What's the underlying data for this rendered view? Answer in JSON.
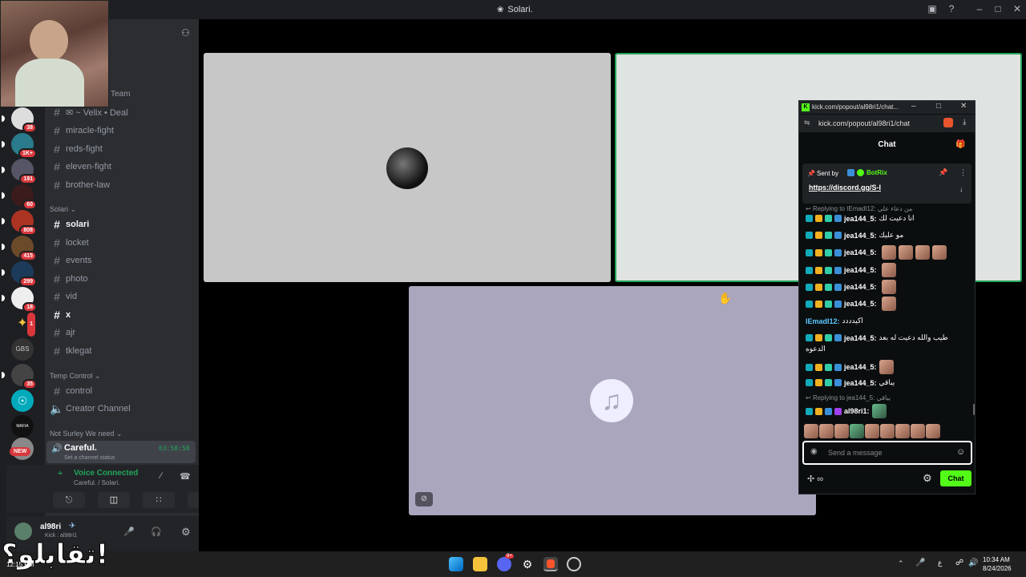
{
  "window": {
    "title": "Solari."
  },
  "sidebar": {
    "server_badges": [
      "38",
      "1K+",
      "191",
      "60",
      "808",
      "415",
      "299",
      "18",
      "1",
      "35"
    ],
    "new_badge": "NEW",
    "team_label": "Team",
    "channels_top": [
      "✉ ~ Velix • Deal",
      "miracle-fight",
      "reds-fight",
      "eleven-fight",
      "brother-law"
    ],
    "category_solari": "Solari",
    "channels_solari": [
      "solari",
      "locket",
      "events",
      "photo",
      "vid",
      "x",
      "ajr",
      "tklegat"
    ],
    "category_temp": "Temp Control",
    "channels_temp": [
      "control",
      "Creator Channel"
    ],
    "category_voice": "Not Surley We need",
    "voice_channel": "Careful.",
    "voice_timer": "63:58:58",
    "voice_status": "Set a channel status",
    "voice_connected": "Voice Connected",
    "voice_location": "Careful. / Solari.",
    "username": "al98ri",
    "user_status": "Kick : al98ri1"
  },
  "popout": {
    "window_title": "kick.com/popout/al98ri1/chat...",
    "url": "kick.com/popout/al98ri1/chat",
    "chat_title": "Chat",
    "pinned_sent_by": "Sent by",
    "pinned_user": "BotRix",
    "pinned_link": "https://discord.gg/S-I",
    "replying1": "Replying to IEmadI12: من دعاء علي",
    "messages": [
      {
        "user": "jea144_5:",
        "text": "انا دعيت لك"
      },
      {
        "user": "jea144_5:",
        "text": "مو عليك"
      },
      {
        "user": "jea144_5:",
        "text": ""
      },
      {
        "user": "jea144_5:",
        "text": ""
      },
      {
        "user": "jea144_5:",
        "text": ""
      },
      {
        "user": "jea144_5:",
        "text": ""
      }
    ],
    "emad_msg_user": "IEmadI12:",
    "emad_msg_text": "اكيدددد",
    "long_msg_user": "jea144_5:",
    "long_msg_text": "طيب والله دعيت له بعد",
    "long_msg_text2": "الدعوه",
    "msg_after1_user": "jea144_5:",
    "msg_after2_user": "jea144_5:",
    "msg_after2_text": "يباقي",
    "replying2": "Replying to jea144_5: يباقي",
    "last_user": "al98ri1:",
    "input_placeholder": "Send a message",
    "chat_button": "Chat"
  },
  "taskbar": {
    "time": "10:34 AM",
    "date": "8/24/2026",
    "lang": "ع",
    "overlay_text": "تقابلو؟!",
    "overlay_time": "12:15 PM",
    "discord_badge": "9+"
  },
  "colors": {
    "kick_green": "#53fc18",
    "discord_green": "#23a55a",
    "danger": "#da373c"
  }
}
